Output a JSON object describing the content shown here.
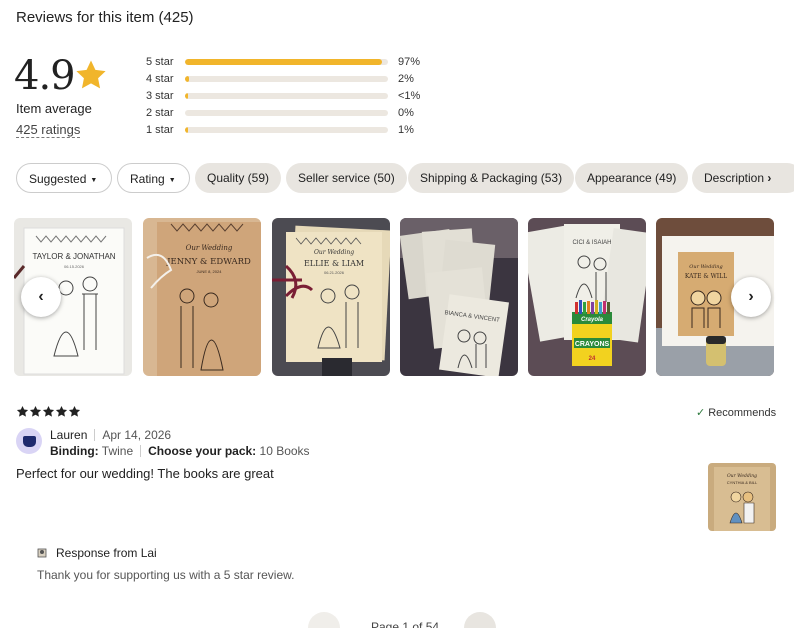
{
  "header": {
    "title": "Reviews for this item (425)"
  },
  "summary": {
    "average": "4.9",
    "average_label": "Item average",
    "ratings_count": "425 ratings",
    "distribution": [
      {
        "label": "5 star",
        "percent_text": "97%",
        "fill": 0.97
      },
      {
        "label": "4 star",
        "percent_text": "2%",
        "fill": 0.02
      },
      {
        "label": "3 star",
        "percent_text": "<1%",
        "fill": 0.005
      },
      {
        "label": "2 star",
        "percent_text": "0%",
        "fill": 0.0
      },
      {
        "label": "1 star",
        "percent_text": "1%",
        "fill": 0.01
      }
    ]
  },
  "filters": [
    {
      "label": "Suggested",
      "dropdown": true
    },
    {
      "label": "Rating",
      "dropdown": true
    },
    {
      "label": "Quality (59)"
    },
    {
      "label": "Seller service (50)"
    },
    {
      "label": "Shipping & Packaging (53)"
    },
    {
      "label": "Appearance (49)"
    },
    {
      "label": "Description"
    }
  ],
  "photos": {
    "prev_label": "‹",
    "next_label": "›",
    "items": [
      {
        "heading": "",
        "names": "TAYLOR & JONATHAN",
        "date": "06.15.2026",
        "bg": "#f3f3f1",
        "kind": "booklet-white"
      },
      {
        "heading": "Our Wedding",
        "names": "JENNY & EDWARD",
        "date": "JUNE 8, 2024",
        "bg": "#c9a27c",
        "kind": "booklet-kraft"
      },
      {
        "heading": "Our Wedding",
        "names": "ELLIE & LIAM",
        "date": "06.21.2026",
        "bg": "#4a4a52",
        "kind": "booklet-ribbon"
      },
      {
        "heading": "",
        "names": "BIANCA & VINCENT",
        "date": "",
        "bg": "#3a3340",
        "kind": "stack"
      },
      {
        "heading": "",
        "names": "CICI & ISAIAH",
        "date": "",
        "bg": "#5b4a52",
        "kind": "crayons"
      },
      {
        "heading": "Our Wedding",
        "names": "KATE & WILL",
        "date": "",
        "bg": "#6b4a3a",
        "kind": "favor"
      }
    ],
    "crayon_box": {
      "brand": "Crayola",
      "label": "CRAYONS",
      "count": "24"
    }
  },
  "review": {
    "stars": 5,
    "recommends": "Recommends",
    "reviewer": "Lauren",
    "date": "Apr 14, 2026",
    "binding_label": "Binding:",
    "binding_value": "Twine",
    "pack_label": "Choose your pack:",
    "pack_value": "10 Books",
    "text": "Perfect for our wedding! The books are great",
    "photo": {
      "heading": "Our Wedding",
      "names": "CYNTHIA & BILL"
    },
    "response_title": "Response from Lai",
    "response_text": "Thank you for supporting us with a 5 star review."
  },
  "pagination": {
    "text": "Page 1 of 54",
    "prev": "←",
    "next": "→"
  },
  "colors": {
    "star": "#f1b52b",
    "bar_track": "#ece7e0",
    "chip_filled": "#e8e5e0",
    "check": "#2d7a3d"
  }
}
